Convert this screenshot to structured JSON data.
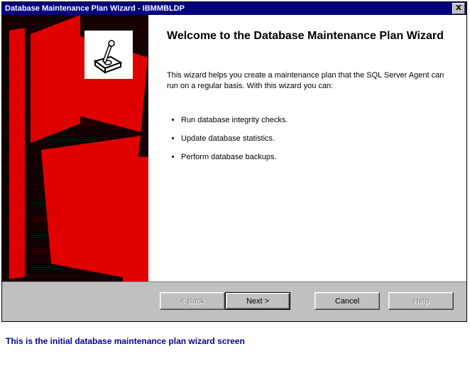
{
  "window": {
    "title": "Database Maintenance Plan Wizard - IBMMBLDP"
  },
  "content": {
    "heading": "Welcome to the Database Maintenance Plan Wizard",
    "intro": "This wizard helps you create a maintenance plan that the SQL Server Agent can run on a regular basis.  With this wizard you can:",
    "bullets": [
      "Run database integrity checks.",
      "Update database statistics.",
      "Perform database backups."
    ]
  },
  "buttons": {
    "back": "< Back",
    "next": "Next >",
    "cancel": "Cancel",
    "help": "Help"
  },
  "caption": "This is the initial database maintenance plan wizard screen"
}
